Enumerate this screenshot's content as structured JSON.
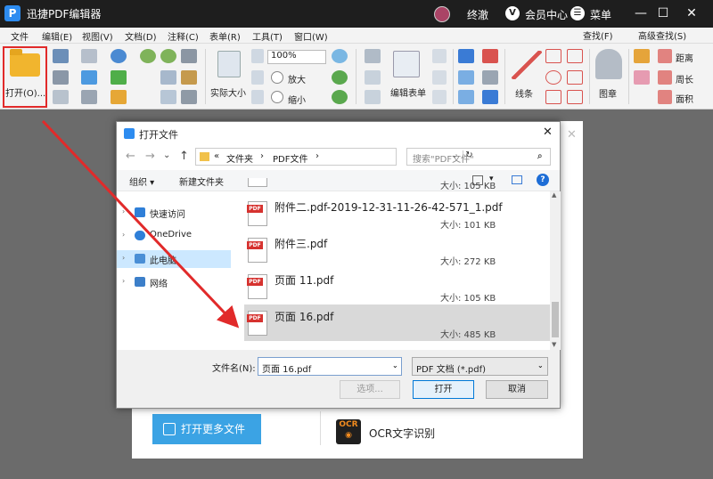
{
  "app": {
    "title": "迅捷PDF编辑器",
    "logo": "P",
    "user_name": "终澈",
    "vip_icon": "V",
    "vip_label": "会员中心",
    "menu_label": "菜单",
    "minimize": "—",
    "maximize": "☐",
    "close": "✕"
  },
  "menubar": {
    "items": [
      "文件",
      "编辑(E)",
      "视图(V)",
      "文档(D)",
      "注释(C)",
      "表单(R)",
      "工具(T)",
      "窗口(W)"
    ],
    "find": "查找(F)",
    "advanced_find": "高级查找(S)"
  },
  "ribbon": {
    "open": "打开(O)...",
    "actual_size": "实际大小",
    "zoom": "100%",
    "zoom_in": "放大",
    "zoom_out": "缩小",
    "edit_form": "编辑表单",
    "line": "线条",
    "stamp": "图章",
    "distance": "距离",
    "perimeter": "周长",
    "area": "面积"
  },
  "dialog": {
    "title": "打开文件",
    "close": "✕",
    "nav_back": "←",
    "nav_forward": "→",
    "nav_recent": "⌄",
    "nav_up": "↑",
    "address_parts": [
      "«",
      "文件夹",
      "›",
      "PDF文件",
      "›"
    ],
    "address_dropdown": "⌄",
    "refresh": "↻",
    "search_placeholder": "搜索\"PDF文件\"",
    "search_icon": "⌕",
    "organize": "组织 ▾",
    "new_folder": "新建文件夹",
    "view_dropdown": "▾",
    "help": "?",
    "nav_items": [
      {
        "label": "快速访问",
        "chev": "›",
        "icon": "star-icon",
        "color": "#2f7fd8"
      },
      {
        "label": "OneDrive",
        "chev": "›",
        "icon": "cloud-icon",
        "color": "#2f7fd8"
      },
      {
        "label": "此电脑",
        "chev": "›",
        "icon": "computer-icon",
        "color": "#4a8fd6",
        "selected": true
      },
      {
        "label": "网络",
        "chev": "›",
        "icon": "network-icon",
        "color": "#3c7fc9"
      }
    ],
    "files": [
      {
        "name": "",
        "size": "大小: 105 KB"
      },
      {
        "name": "附件二.pdf-2019-12-31-11-26-42-571_1.pdf",
        "size": "大小: 101 KB"
      },
      {
        "name": "附件三.pdf",
        "size": "大小: 272 KB"
      },
      {
        "name": "页面 11.pdf",
        "size": "大小: 105 KB"
      },
      {
        "name": "页面 16.pdf",
        "size": "大小: 485 KB",
        "selected": true
      }
    ],
    "scroll_up": "▲",
    "scroll_down": "▼",
    "filename_label": "文件名(N):",
    "filename_value": "页面 16.pdf",
    "filename_dropdown": "⌄",
    "filetype": "PDF 文档 (*.pdf)",
    "filetype_dropdown": "⌄",
    "options_btn": "选项...",
    "open_btn": "打开",
    "cancel_btn": "取消"
  },
  "background_panel": {
    "open_more": "打开更多文件",
    "ocr_icon_text": "OCR",
    "ocr_label": "OCR文字识别",
    "close": "✕"
  },
  "colors": {
    "accent_red": "#e12a2a",
    "brand_blue": "#3ba3e4"
  }
}
